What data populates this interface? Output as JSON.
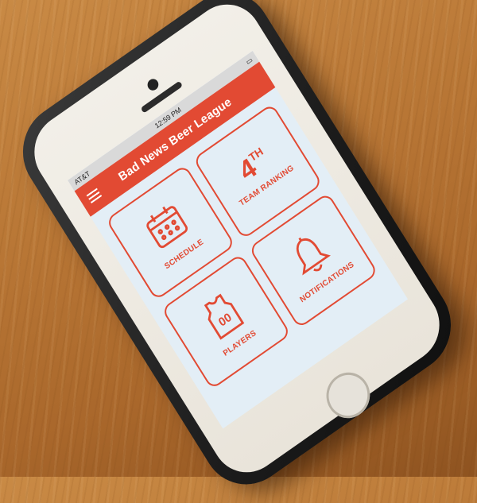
{
  "status_bar": {
    "carrier": "AT&T",
    "time": "12:59 PM"
  },
  "app_bar": {
    "title": "Bad News Beer League",
    "menu_icon": "hamburger-menu-icon"
  },
  "tiles": [
    {
      "label": "SCHEDULE",
      "icon": "calendar-icon"
    },
    {
      "label": "TEAM RANKING",
      "rank_number": "4",
      "rank_suffix": "TH"
    },
    {
      "label": "PLAYERS",
      "icon": "jersey-icon",
      "jersey_number": "00"
    },
    {
      "label": "NOTIFICATIONS",
      "icon": "bell-icon"
    }
  ],
  "colors": {
    "accent": "#e24a33",
    "screen_background": "#e3eef6"
  }
}
